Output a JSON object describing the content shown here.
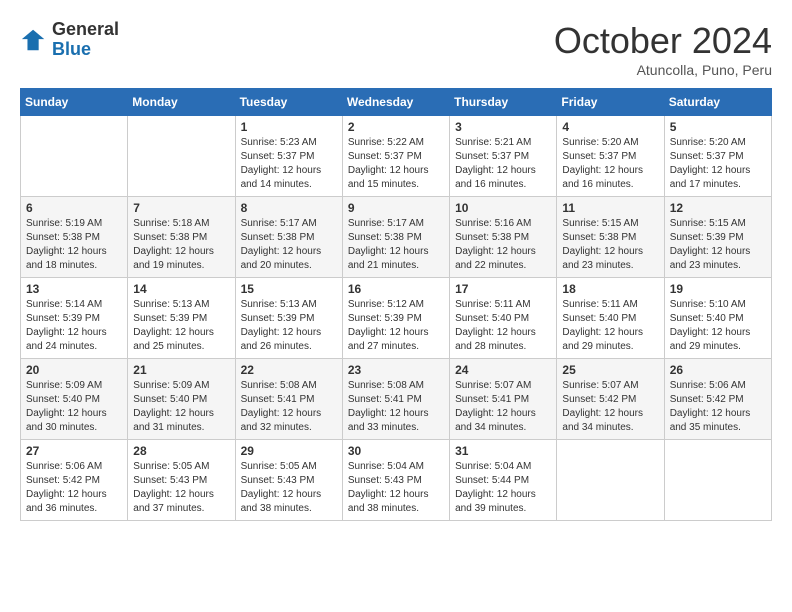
{
  "logo": {
    "general": "General",
    "blue": "Blue"
  },
  "title": "October 2024",
  "subtitle": "Atuncolla, Puno, Peru",
  "days_header": [
    "Sunday",
    "Monday",
    "Tuesday",
    "Wednesday",
    "Thursday",
    "Friday",
    "Saturday"
  ],
  "weeks": [
    [
      {
        "day": "",
        "info": ""
      },
      {
        "day": "",
        "info": ""
      },
      {
        "day": "1",
        "info": "Sunrise: 5:23 AM\nSunset: 5:37 PM\nDaylight: 12 hours and 14 minutes."
      },
      {
        "day": "2",
        "info": "Sunrise: 5:22 AM\nSunset: 5:37 PM\nDaylight: 12 hours and 15 minutes."
      },
      {
        "day": "3",
        "info": "Sunrise: 5:21 AM\nSunset: 5:37 PM\nDaylight: 12 hours and 16 minutes."
      },
      {
        "day": "4",
        "info": "Sunrise: 5:20 AM\nSunset: 5:37 PM\nDaylight: 12 hours and 16 minutes."
      },
      {
        "day": "5",
        "info": "Sunrise: 5:20 AM\nSunset: 5:37 PM\nDaylight: 12 hours and 17 minutes."
      }
    ],
    [
      {
        "day": "6",
        "info": "Sunrise: 5:19 AM\nSunset: 5:38 PM\nDaylight: 12 hours and 18 minutes."
      },
      {
        "day": "7",
        "info": "Sunrise: 5:18 AM\nSunset: 5:38 PM\nDaylight: 12 hours and 19 minutes."
      },
      {
        "day": "8",
        "info": "Sunrise: 5:17 AM\nSunset: 5:38 PM\nDaylight: 12 hours and 20 minutes."
      },
      {
        "day": "9",
        "info": "Sunrise: 5:17 AM\nSunset: 5:38 PM\nDaylight: 12 hours and 21 minutes."
      },
      {
        "day": "10",
        "info": "Sunrise: 5:16 AM\nSunset: 5:38 PM\nDaylight: 12 hours and 22 minutes."
      },
      {
        "day": "11",
        "info": "Sunrise: 5:15 AM\nSunset: 5:38 PM\nDaylight: 12 hours and 23 minutes."
      },
      {
        "day": "12",
        "info": "Sunrise: 5:15 AM\nSunset: 5:39 PM\nDaylight: 12 hours and 23 minutes."
      }
    ],
    [
      {
        "day": "13",
        "info": "Sunrise: 5:14 AM\nSunset: 5:39 PM\nDaylight: 12 hours and 24 minutes."
      },
      {
        "day": "14",
        "info": "Sunrise: 5:13 AM\nSunset: 5:39 PM\nDaylight: 12 hours and 25 minutes."
      },
      {
        "day": "15",
        "info": "Sunrise: 5:13 AM\nSunset: 5:39 PM\nDaylight: 12 hours and 26 minutes."
      },
      {
        "day": "16",
        "info": "Sunrise: 5:12 AM\nSunset: 5:39 PM\nDaylight: 12 hours and 27 minutes."
      },
      {
        "day": "17",
        "info": "Sunrise: 5:11 AM\nSunset: 5:40 PM\nDaylight: 12 hours and 28 minutes."
      },
      {
        "day": "18",
        "info": "Sunrise: 5:11 AM\nSunset: 5:40 PM\nDaylight: 12 hours and 29 minutes."
      },
      {
        "day": "19",
        "info": "Sunrise: 5:10 AM\nSunset: 5:40 PM\nDaylight: 12 hours and 29 minutes."
      }
    ],
    [
      {
        "day": "20",
        "info": "Sunrise: 5:09 AM\nSunset: 5:40 PM\nDaylight: 12 hours and 30 minutes."
      },
      {
        "day": "21",
        "info": "Sunrise: 5:09 AM\nSunset: 5:40 PM\nDaylight: 12 hours and 31 minutes."
      },
      {
        "day": "22",
        "info": "Sunrise: 5:08 AM\nSunset: 5:41 PM\nDaylight: 12 hours and 32 minutes."
      },
      {
        "day": "23",
        "info": "Sunrise: 5:08 AM\nSunset: 5:41 PM\nDaylight: 12 hours and 33 minutes."
      },
      {
        "day": "24",
        "info": "Sunrise: 5:07 AM\nSunset: 5:41 PM\nDaylight: 12 hours and 34 minutes."
      },
      {
        "day": "25",
        "info": "Sunrise: 5:07 AM\nSunset: 5:42 PM\nDaylight: 12 hours and 34 minutes."
      },
      {
        "day": "26",
        "info": "Sunrise: 5:06 AM\nSunset: 5:42 PM\nDaylight: 12 hours and 35 minutes."
      }
    ],
    [
      {
        "day": "27",
        "info": "Sunrise: 5:06 AM\nSunset: 5:42 PM\nDaylight: 12 hours and 36 minutes."
      },
      {
        "day": "28",
        "info": "Sunrise: 5:05 AM\nSunset: 5:43 PM\nDaylight: 12 hours and 37 minutes."
      },
      {
        "day": "29",
        "info": "Sunrise: 5:05 AM\nSunset: 5:43 PM\nDaylight: 12 hours and 38 minutes."
      },
      {
        "day": "30",
        "info": "Sunrise: 5:04 AM\nSunset: 5:43 PM\nDaylight: 12 hours and 38 minutes."
      },
      {
        "day": "31",
        "info": "Sunrise: 5:04 AM\nSunset: 5:44 PM\nDaylight: 12 hours and 39 minutes."
      },
      {
        "day": "",
        "info": ""
      },
      {
        "day": "",
        "info": ""
      }
    ]
  ]
}
